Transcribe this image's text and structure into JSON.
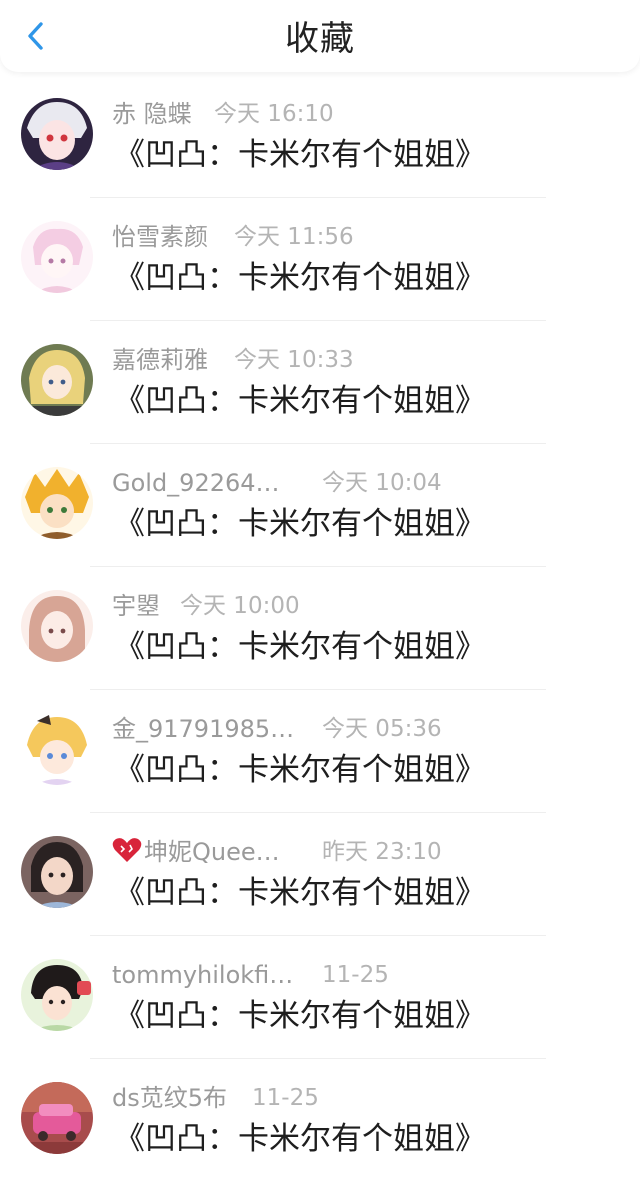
{
  "header": {
    "title": "收藏",
    "back_icon": "chevron-left-icon",
    "accent_color": "#2f96e8"
  },
  "items": [
    {
      "name": "赤 隐蝶",
      "time": "今天 16:10",
      "message": "《凹凸：卡米尔有个姐姐》",
      "avatar_color": "#3a2d56"
    },
    {
      "name": "怡雪素颜",
      "time": "今天 11:56",
      "message": "《凹凸：卡米尔有个姐姐》",
      "avatar_color": "#f5d9ec"
    },
    {
      "name": "嘉德莉雅",
      "time": "今天 10:33",
      "message": "《凹凸：卡米尔有个姐姐》",
      "avatar_color": "#c9bd6a"
    },
    {
      "name": "Gold_92264…",
      "time": "今天 10:04",
      "message": "《凹凸：卡米尔有个姐姐》",
      "avatar_color": "#e3a42d"
    },
    {
      "name": "宇曌",
      "time": "今天 10:00",
      "message": "《凹凸：卡米尔有个姐姐》",
      "avatar_color": "#f0cfc6"
    },
    {
      "name": "金_91791985…",
      "time": "今天 05:36",
      "message": "《凹凸：卡米尔有个姐姐》",
      "avatar_color": "#f6d27a"
    },
    {
      "name": "坤妮Quee…",
      "time": "昨天 23:10",
      "message": "《凹凸：卡米尔有个姐姐》",
      "avatar_color": "#8d6b67",
      "badge_icon": "heart-icon"
    },
    {
      "name": "tommyhilokfi…",
      "time": "11-25",
      "message": "《凹凸：卡米尔有个姐姐》",
      "avatar_color": "#7dbf6a"
    },
    {
      "name": "ds苋纹5布",
      "time": "11-25",
      "message": "《凹凸：卡米尔有个姐姐》",
      "avatar_color": "#d85a92"
    }
  ]
}
